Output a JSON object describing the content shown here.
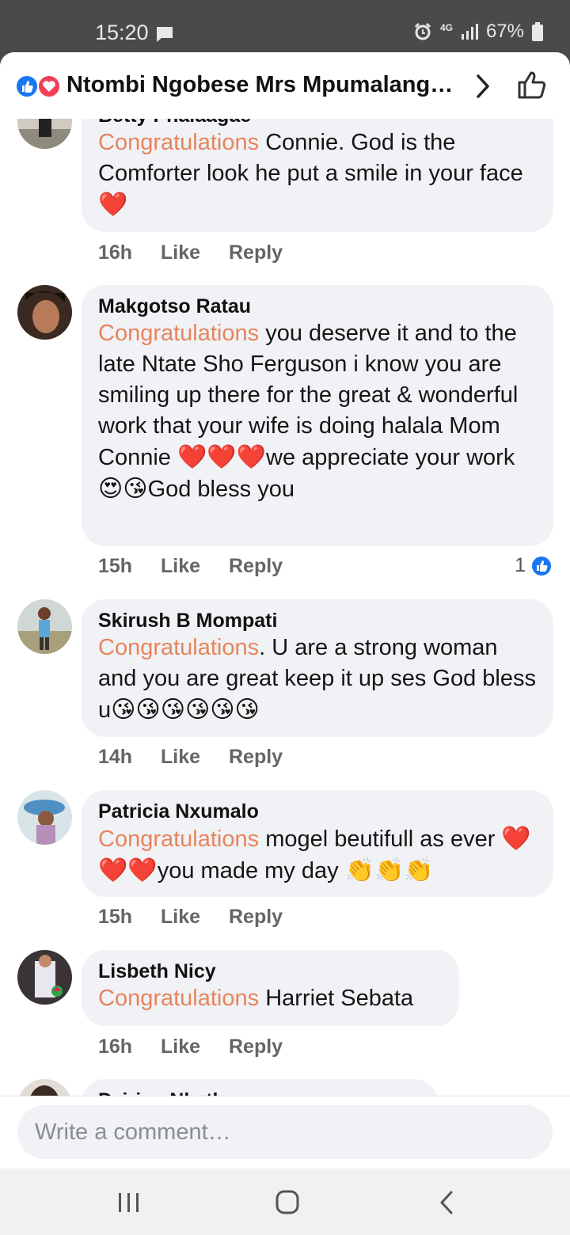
{
  "status_bar": {
    "time": "15:20",
    "network": "4G",
    "battery": "67%"
  },
  "header": {
    "title": "Ntombi Ngobese Mrs Mpumalang…"
  },
  "comments": [
    {
      "author": "Betty Phalaagae",
      "keyword": "Congratulations",
      "text": "  Connie. God is the Comforter look he put a smile in your face",
      "emoji": "❤️",
      "time": "16h",
      "like": "Like",
      "reply": "Reply"
    },
    {
      "author": "Makgotso Ratau",
      "keyword": "Congratulations",
      "text_a": " you deserve it and to the late Ntate Sho Ferguson i know you are smiling up there for the great & wonderful work that your wife is doing halala Mom Connie ",
      "emoji_a": "❤️❤️❤️",
      "text_b": "we appreciate your work",
      "emoji_b": "😍😘",
      "text_c": "God bless you",
      "time": "15h",
      "like": "Like",
      "reply": "Reply",
      "likes": "1"
    },
    {
      "author": "Skirush B Mompati",
      "keyword": "Congratulations",
      "text": ". U are a strong woman and you are great keep it up ses God bless u",
      "emoji": "😘😘😘😘😘😘",
      "time": "14h",
      "like": "Like",
      "reply": "Reply"
    },
    {
      "author": "Patricia Nxumalo",
      "keyword": "Congratulations",
      "text_a": " mogel beutifull as ever ",
      "emoji_a": "❤️❤️❤️",
      "text_b": "you made my day ",
      "emoji_b": "👏👏👏",
      "time": "15h",
      "like": "Like",
      "reply": "Reply"
    },
    {
      "author": "Lisbeth Nicy",
      "keyword": "Congratulations",
      "text": " Harriet Sebata",
      "time": "16h",
      "like": "Like",
      "reply": "Reply"
    },
    {
      "author": "Dziriso Nkatha"
    }
  ],
  "composer": {
    "placeholder": "Write a comment…"
  },
  "colors": {
    "keyword": "#e8845d",
    "bubble": "#f0f2f5",
    "like_blue": "#1877f2",
    "love_red": "#f33e58"
  },
  "icons": [
    "message-icon",
    "alarm-icon",
    "signal-icon",
    "battery-icon",
    "like-reaction-icon",
    "love-reaction-icon",
    "chevron-right-icon",
    "thumbs-up-icon",
    "recents-icon",
    "home-icon",
    "back-icon"
  ]
}
